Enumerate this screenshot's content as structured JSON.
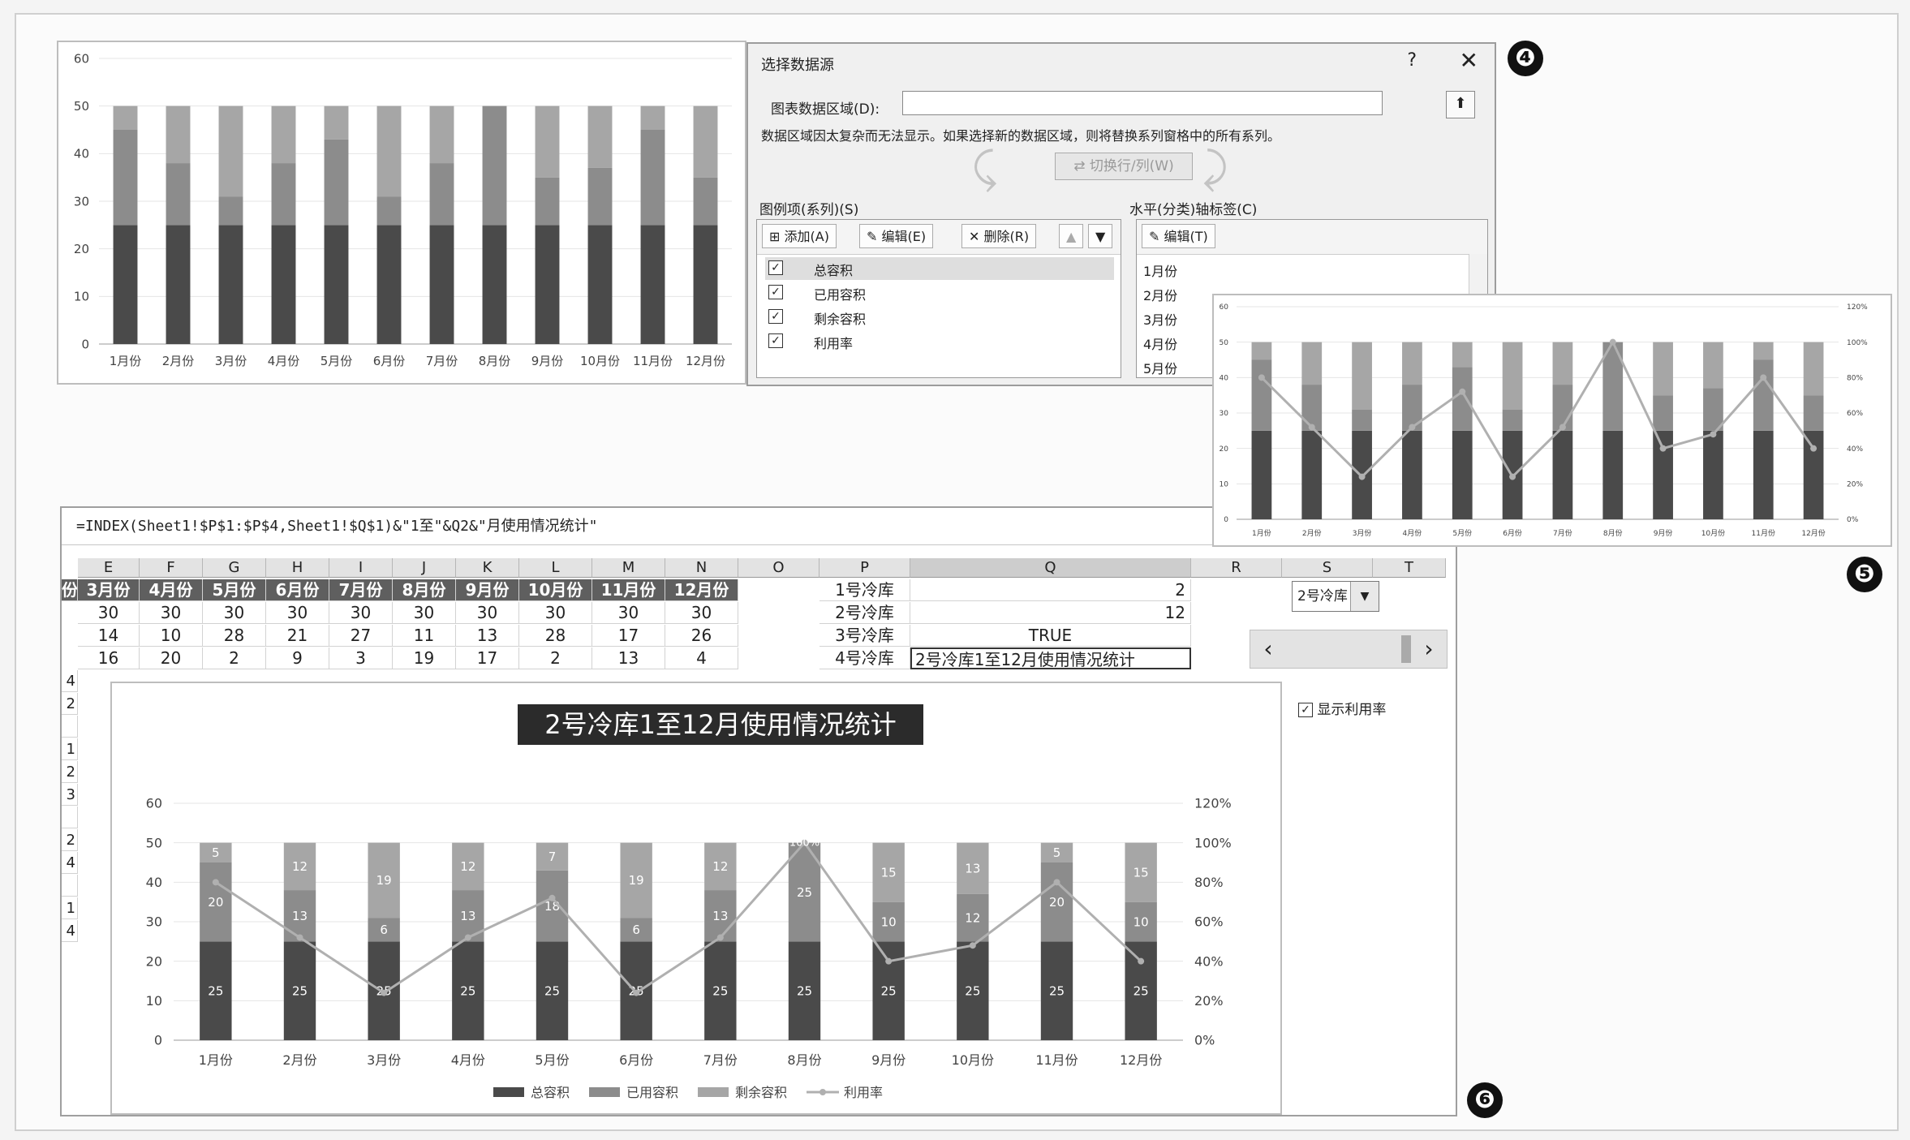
{
  "badges": [
    "❹",
    "❺",
    "❻"
  ],
  "chart_data": [
    {
      "type": "bar",
      "categories": [
        "1月份",
        "2月份",
        "3月份",
        "4月份",
        "5月份",
        "6月份",
        "7月份",
        "8月份",
        "9月份",
        "10月份",
        "11月份",
        "12月份"
      ],
      "series": [
        {
          "values": [
            25,
            25,
            25,
            25,
            25,
            25,
            25,
            25,
            25,
            25,
            25,
            25
          ],
          "color": "#4a4a4a"
        },
        {
          "values": [
            20,
            13,
            6,
            13,
            18,
            6,
            13,
            25,
            10,
            12,
            20,
            10
          ],
          "color": "#8c8c8c"
        },
        {
          "values": [
            5,
            12,
            19,
            12,
            7,
            19,
            12,
            0,
            15,
            13,
            5,
            15
          ],
          "color": "#a6a6a6"
        }
      ],
      "y_ticks": [
        "0",
        "10",
        "20",
        "30",
        "40",
        "50",
        "60"
      ],
      "ylim": [
        0,
        60
      ],
      "stacked": true
    },
    {
      "type": "bar",
      "categories": [
        "1月份",
        "2月份",
        "3月份",
        "4月份",
        "5月份",
        "6月份",
        "7月份",
        "8月份",
        "9月份",
        "10月份",
        "11月份",
        "12月份"
      ],
      "series": [
        {
          "values": [
            25,
            25,
            25,
            25,
            25,
            25,
            25,
            25,
            25,
            25,
            25,
            25
          ],
          "color": "#4a4a4a"
        },
        {
          "values": [
            20,
            13,
            6,
            13,
            18,
            6,
            13,
            25,
            10,
            12,
            20,
            10
          ],
          "color": "#8c8c8c"
        },
        {
          "values": [
            5,
            12,
            19,
            12,
            7,
            19,
            12,
            0,
            15,
            13,
            5,
            15
          ],
          "color": "#a6a6a6"
        },
        {
          "values": [
            0.8,
            0.52,
            0.24,
            0.52,
            0.72,
            0.24,
            0.52,
            1.0,
            0.4,
            0.48,
            0.8,
            0.4
          ],
          "color": "#b0b0b0",
          "type": "line",
          "axis": "right"
        }
      ],
      "y_ticks": [
        "0",
        "10",
        "20",
        "30",
        "40",
        "50",
        "60"
      ],
      "y2_ticks": [
        "0%",
        "20%",
        "40%",
        "60%",
        "80%",
        "100%",
        "120%"
      ],
      "ylim": [
        0,
        60
      ],
      "y2lim": [
        0,
        1.2
      ],
      "stacked": true
    },
    {
      "type": "bar",
      "title": "2号冷库1至12月使用情况统计",
      "categories": [
        "1月份",
        "2月份",
        "3月份",
        "4月份",
        "5月份",
        "6月份",
        "7月份",
        "8月份",
        "9月份",
        "10月份",
        "11月份",
        "12月份"
      ],
      "series": [
        {
          "name": "总容积",
          "values": [
            25,
            25,
            25,
            25,
            25,
            25,
            25,
            25,
            25,
            25,
            25,
            25
          ],
          "color": "#4a4a4a"
        },
        {
          "name": "已用容积",
          "values": [
            20,
            13,
            6,
            13,
            18,
            6,
            13,
            25,
            10,
            12,
            20,
            10
          ],
          "color": "#8c8c8c"
        },
        {
          "name": "剩余容积",
          "values": [
            5,
            12,
            19,
            12,
            7,
            19,
            12,
            0,
            15,
            13,
            5,
            15
          ],
          "color": "#a6a6a6"
        },
        {
          "name": "利用率",
          "values": [
            0.8,
            0.52,
            0.24,
            0.52,
            0.72,
            0.24,
            0.52,
            1.0,
            0.4,
            0.48,
            0.8,
            0.4
          ],
          "color": "#b0b0b0",
          "type": "line",
          "axis": "right"
        }
      ],
      "y_ticks": [
        "0",
        "10",
        "20",
        "30",
        "40",
        "50",
        "60"
      ],
      "y2_ticks": [
        "0%",
        "20%",
        "40%",
        "60%",
        "80%",
        "100%",
        "120%"
      ],
      "ylim": [
        0,
        60
      ],
      "y2lim": [
        0,
        1.2
      ],
      "stacked": true,
      "legend": "bottom",
      "data_labels": true,
      "visible_percent_label": "100%"
    }
  ],
  "dialog": {
    "title": "选择数据源",
    "help": "?",
    "close": "✕",
    "range_label": "图表数据区域(D):",
    "range_value": "",
    "range_button": "⬆",
    "message": "数据区域因太复杂而无法显示。如果选择新的数据区域，则将替换系列窗格中的所有系列。",
    "switch_label": "切换行/列(W)",
    "legend_label": "图例项(系列)(S)",
    "axis_label": "水平(分类)轴标签(C)",
    "add": "添加(A)",
    "edit": "编辑(E)",
    "delete": "删除(R)",
    "up": "▲",
    "down": "▼",
    "axis_edit": "编辑(T)",
    "series": [
      "总容积",
      "已用容积",
      "剩余容积",
      "利用率"
    ],
    "axis_items": [
      "1月份",
      "2月份",
      "3月份",
      "4月份",
      "5月份"
    ],
    "check": "✓"
  },
  "sheet": {
    "formula": "=INDEX(Sheet1!$P$1:$P$4,Sheet1!$Q$1)&\"1至\"&Q2&\"月使用情况统计\"",
    "columns": [
      "E",
      "F",
      "G",
      "H",
      "I",
      "J",
      "K",
      "L",
      "M",
      "N",
      "O",
      "P",
      "Q",
      "R",
      "S",
      "T"
    ],
    "month_headers": [
      "份",
      "3月份",
      "4月份",
      "5月份",
      "6月份",
      "7月份",
      "8月份",
      "9月份",
      "10月份",
      "11月份",
      "12月份"
    ],
    "rows": [
      [
        "30",
        "30",
        "30",
        "30",
        "30",
        "30",
        "30",
        "30",
        "30",
        "30"
      ],
      [
        "14",
        "10",
        "28",
        "21",
        "27",
        "11",
        "13",
        "28",
        "17",
        "26"
      ],
      [
        "16",
        "20",
        "2",
        "9",
        "3",
        "19",
        "17",
        "2",
        "13",
        "4"
      ]
    ],
    "left_partial": [
      "4",
      "2",
      "",
      "1",
      "2",
      "3",
      "",
      "2",
      "4",
      "",
      "1",
      "4"
    ],
    "p_labels": [
      "1号冷库",
      "2号冷库",
      "3号冷库",
      "4号冷库"
    ],
    "q_values": [
      "2",
      "12",
      "TRUE",
      "2号冷库1至12月使用情况统计"
    ],
    "dropdown_value": "2号冷库",
    "dropdown_arrow": "▼",
    "scroll_left": "‹",
    "scroll_right": "›",
    "show_rate_label": "显示利用率",
    "show_rate_check": "✓"
  }
}
